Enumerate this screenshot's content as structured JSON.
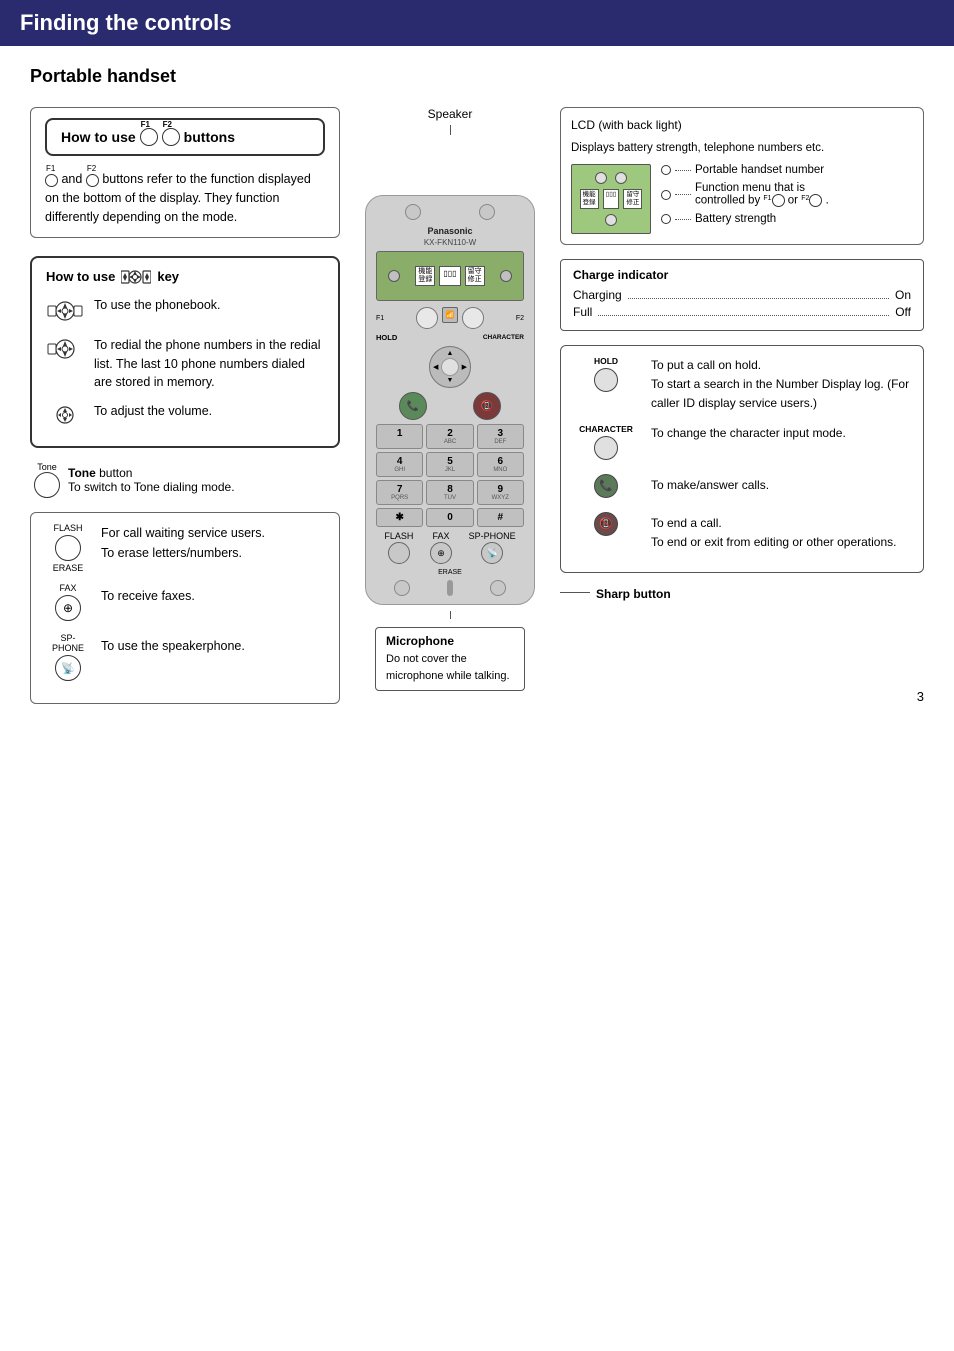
{
  "header": {
    "title": "Finding the controls",
    "bg_color": "#2a2a6e"
  },
  "section": {
    "title": "Portable handset"
  },
  "left": {
    "how_to_use_f_box": {
      "prefix": "How to use",
      "f1_label": "F1",
      "f2_label": "F2",
      "suffix": "buttons",
      "description": "and  buttons refer to the function displayed on the bottom of the display. They function differently depending on the mode."
    },
    "how_to_use_key_box": {
      "title_prefix": "How to use",
      "title_suffix": "key",
      "items": [
        {
          "description": "To use the phonebook."
        },
        {
          "description": "To redial the phone numbers in the redial list. The last 10 phone numbers dialed are stored in memory."
        },
        {
          "description": "To adjust the volume."
        }
      ]
    },
    "tone_section": {
      "label": "Tone",
      "label_suffix": " button",
      "description": "To switch to Tone dialing mode."
    },
    "bottom_box": {
      "items": [
        {
          "label": "FLASH",
          "label2": "ERASE",
          "description1": "For call waiting service users.",
          "description2": "To erase letters/numbers."
        },
        {
          "label": "FAX",
          "description": "To receive faxes."
        },
        {
          "label": "SP-PHONE",
          "description": "To use the speakerphone."
        }
      ]
    }
  },
  "center": {
    "speaker_label": "Speaker",
    "phone_brand": "Panasonic",
    "phone_model": "KX-FKN110-W",
    "mic_title": "Microphone",
    "mic_description": "Do not cover the microphone while talking.",
    "numpad": [
      {
        "num": "1",
        "letters": ""
      },
      {
        "num": "2",
        "letters": "ABC"
      },
      {
        "num": "3",
        "letters": "DEF"
      },
      {
        "num": "4",
        "letters": "GHI"
      },
      {
        "num": "5",
        "letters": "JKL"
      },
      {
        "num": "6",
        "letters": "MNO"
      },
      {
        "num": "7",
        "letters": "PQRS"
      },
      {
        "num": "8",
        "letters": "TUV"
      },
      {
        "num": "9",
        "letters": "WXYZ"
      },
      {
        "num": "*",
        "letters": ""
      },
      {
        "num": "0",
        "letters": ""
      },
      {
        "num": "#",
        "letters": ""
      }
    ],
    "hold_label": "HOLD",
    "character_label": "CHARACTER",
    "flash_label": "FLASH",
    "fax_label": "FAX",
    "sp_phone_label": "SP-PHONE",
    "erase_label": "ERASE"
  },
  "right": {
    "lcd_section": {
      "title": "LCD (with back light)",
      "description": "Displays battery strength, telephone numbers etc.",
      "indicators": [
        "Portable handset number",
        "Function menu that is controlled by  or .",
        "Battery strength"
      ],
      "kanji1_line1": "機能",
      "kanji1_line2": "登録",
      "kanji2_middle": "777",
      "kanji3_line1": "留守",
      "kanji3_line2": "修正"
    },
    "charge_box": {
      "title": "Charge indicator",
      "charging_label": "Charging",
      "charging_value": "On",
      "full_label": "Full",
      "full_value": "Off"
    },
    "function_items": [
      {
        "label": "HOLD",
        "descriptions": [
          "To put a call on hold.",
          "To start a search in the Number Display log. (For caller ID display service users.)"
        ]
      },
      {
        "label": "CHARACTER",
        "descriptions": [
          "To change the character input mode."
        ]
      },
      {
        "label": "answer-call",
        "descriptions": [
          "To make/answer calls."
        ]
      },
      {
        "label": "end-call",
        "descriptions": [
          "To end a call.",
          "To end or exit from editing or other operations."
        ]
      }
    ],
    "sharp_button_label": "Sharp button"
  },
  "page_number": "3"
}
